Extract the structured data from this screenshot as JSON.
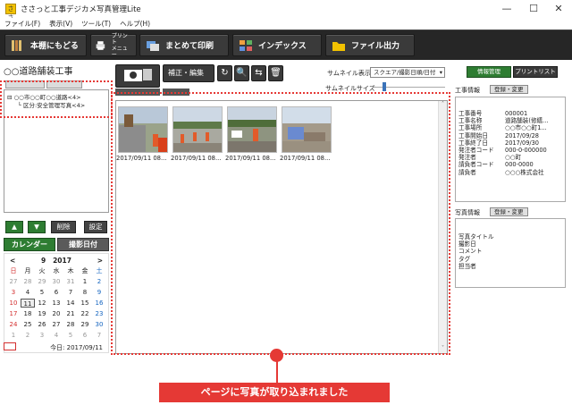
{
  "window": {
    "title": "ささっと工事デジカメ写真管理Lite",
    "app_icon": "app-icon",
    "minimize": "—",
    "maximize": "☐",
    "close": "✕"
  },
  "menu": [
    "ファイル(F)",
    "表示(V)",
    "ツール(T)",
    "ヘルプ(H)"
  ],
  "toolbar": {
    "back_label": "本棚にもどる",
    "print_menu_label_1": "プリント",
    "print_menu_label_2": "メニュー",
    "bulk_print_label": "まとめて印刷",
    "index_label": "インデックス",
    "file_export_label": "ファイル出力"
  },
  "left": {
    "project_title": "○○道路舗装工事",
    "tree": [
      "○○市○○町○○道路<4>",
      "区分:安全管理写真<4>"
    ],
    "buttons": {
      "up": "▲",
      "down": "▼",
      "delete": "削除",
      "settings": "設定"
    },
    "tabs": {
      "calendar": "カレンダー",
      "shot_date": "撮影日付"
    },
    "calendar": {
      "month": "9",
      "year": "2017",
      "prev": "<",
      "next": ">",
      "weekdays": [
        "日",
        "月",
        "火",
        "水",
        "木",
        "金",
        "土"
      ],
      "weeks": [
        [
          "27",
          "28",
          "29",
          "30",
          "31",
          "1",
          "2"
        ],
        [
          "3",
          "4",
          "5",
          "6",
          "7",
          "8",
          "9"
        ],
        [
          "10",
          "11",
          "12",
          "13",
          "14",
          "15",
          "16"
        ],
        [
          "17",
          "18",
          "19",
          "20",
          "21",
          "22",
          "23"
        ],
        [
          "24",
          "25",
          "26",
          "27",
          "28",
          "29",
          "30"
        ],
        [
          "1",
          "2",
          "3",
          "4",
          "5",
          "6",
          "7"
        ]
      ],
      "selected_day": "11"
    },
    "today_label": "今日: 2017/09/11"
  },
  "center": {
    "edit_label": "補正・編集",
    "thumb_view_label": "サムネイル表示",
    "thumb_view_value": "スクエア/撮影日順/日付",
    "thumb_size_label": "サムネイルサイズ",
    "thumb_size_value": 0.12,
    "photos": [
      {
        "caption": "2017/09/11 08..."
      },
      {
        "caption": "2017/09/11 08..."
      },
      {
        "caption": "2017/09/11 08..."
      },
      {
        "caption": "2017/09/11 08..."
      }
    ]
  },
  "right": {
    "info_button": "情報管理",
    "printlist_button": "プリントリスト",
    "construction_info_label": "工事情報",
    "register_change_label": "登録・変更",
    "construction_info": [
      {
        "k": "工事番号",
        "v": "000001"
      },
      {
        "k": "工事名称",
        "v": "道路舗装(修繕..."
      },
      {
        "k": "工事場所",
        "v": "○○市○○町1..."
      },
      {
        "k": "工事開始日",
        "v": "2017/09/28"
      },
      {
        "k": "工事終了日",
        "v": "2017/09/30"
      },
      {
        "k": "発注者コード",
        "v": "000-0-000000"
      },
      {
        "k": "発注者",
        "v": "○○町"
      },
      {
        "k": "請負者コード",
        "v": "000-0000"
      },
      {
        "k": "請負者",
        "v": "○○○株式会社"
      }
    ],
    "photo_info_label": "写真情報",
    "photo_info": [
      "写真タイトル",
      "撮影日",
      "コメント",
      "タグ",
      "担当者"
    ]
  },
  "callout_text": "ページに写真が取り込まれました",
  "colors": {
    "accent_green": "#2e7d32",
    "toolbar_bg": "#262626",
    "annotation_red": "#e53935"
  }
}
